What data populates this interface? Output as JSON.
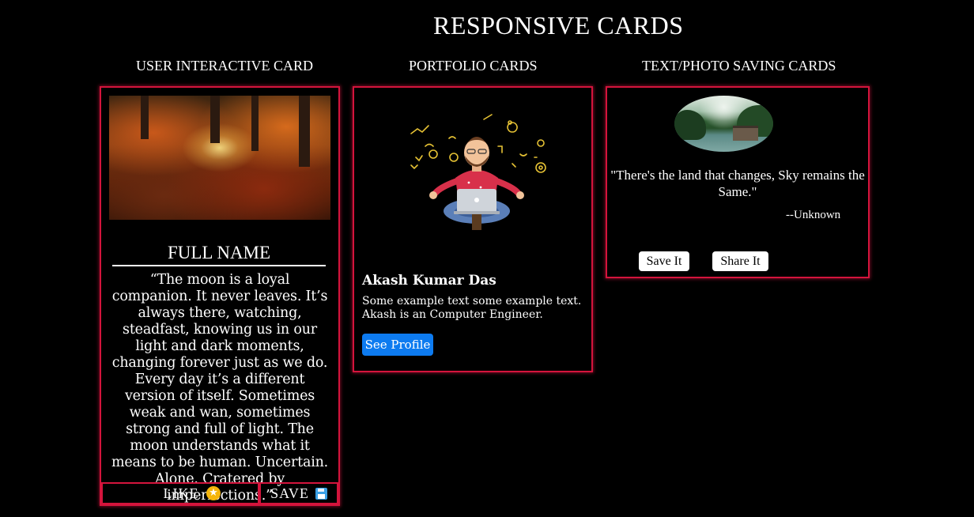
{
  "page": {
    "title": "RESPONSIVE CARDS"
  },
  "columns": {
    "user_card_heading": "USER INTERACTIVE CARD",
    "portfolio_heading": "PORTFOLIO CARDS",
    "saving_heading": "TEXT/PHOTO SAVING CARDS"
  },
  "user_card": {
    "image_icon": "autumn-forest-photo",
    "name": "FULL NAME",
    "quote": "“The moon is a loyal companion. It never leaves. It’s always there, watching, steadfast, knowing us in our light and dark moments, changing forever just as we do. Every day it’s a different version of itself. Sometimes weak and wan, sometimes strong and full of light. The moon understands what it means to be human. Uncertain. Alone. Cratered by imperfections.”",
    "like_label": "LIKE",
    "like_icon": "star-icon",
    "save_label": "SAVE",
    "save_icon": "floppy-disk-icon"
  },
  "portfolio_card": {
    "image_icon": "developer-meditating-illustration",
    "name": "Akash Kumar Das",
    "text": "Some example text some example text. Akash is an Computer Engineer.",
    "button_label": "See Profile",
    "button_color": "#0d7bf0"
  },
  "saving_card": {
    "image_icon": "river-landscape-photo",
    "quote": "\"There's the land that changes, Sky remains the Same.\"",
    "author": "--Unknown",
    "save_label": "Save It",
    "share_label": "Share It"
  },
  "colors": {
    "background": "#000000",
    "card_border": "#d4143c",
    "text": "#ffffff"
  }
}
